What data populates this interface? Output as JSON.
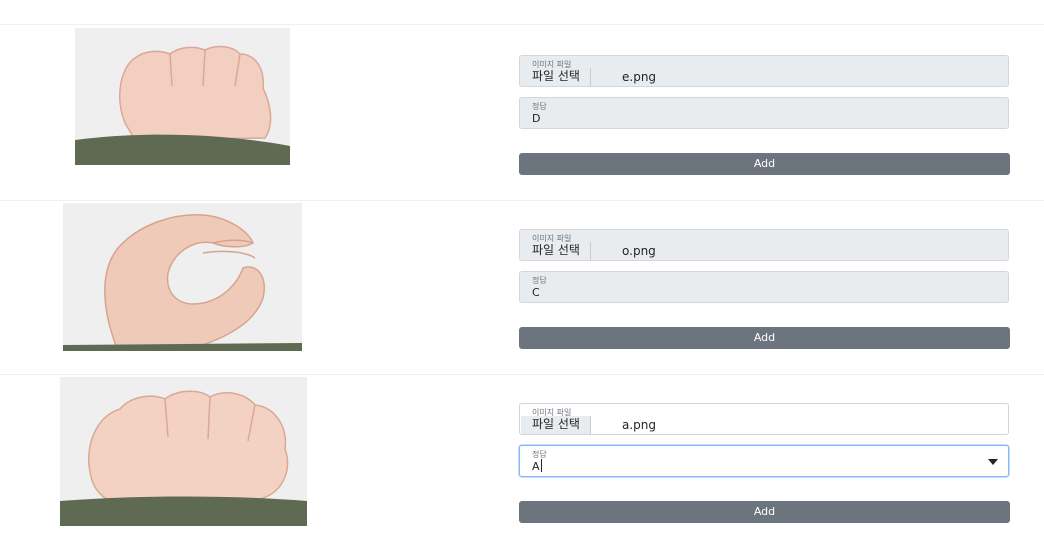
{
  "cards": [
    {
      "image_alt": "hand sign photo",
      "file_label": "이미지 파일",
      "file_button": "파일 선택",
      "file_name": "e.png",
      "answer_label": "정답",
      "answer_value": "D",
      "add_label": "Add"
    },
    {
      "image_alt": "hand sign photo",
      "file_label": "이미지 파일",
      "file_button": "파일 선택",
      "file_name": "o.png",
      "answer_label": "정답",
      "answer_value": "C",
      "add_label": "Add"
    },
    {
      "image_alt": "hand sign photo",
      "file_label": "이미지 파일",
      "file_button": "파일 선택",
      "file_name": "a.png",
      "answer_label": "정답",
      "answer_value": "A",
      "add_label": "Add"
    }
  ],
  "colors": {
    "add_button": "#6c757d",
    "field_disabled": "#e9ecef",
    "focus_border": "#86b7fe"
  }
}
